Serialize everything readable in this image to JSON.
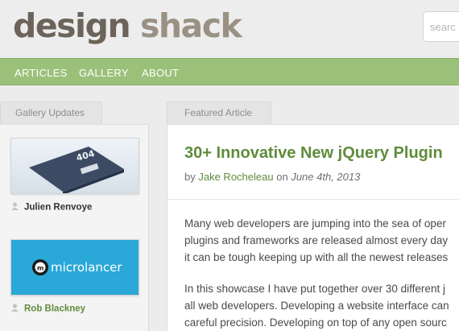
{
  "header": {
    "logo_word1": "design",
    "logo_word2": "shack",
    "search_placeholder": "searc"
  },
  "nav": {
    "items": [
      "ARTICLES",
      "GALLERY",
      "ABOUT"
    ]
  },
  "sidebar": {
    "tab_label": "Gallery Updates",
    "entries": [
      {
        "thumb_text": "404",
        "author": "Julien Renvoye"
      },
      {
        "thumb_text": "microlancer",
        "author": "Rob Blackney"
      }
    ]
  },
  "article": {
    "tab_label": "Featured Article",
    "title": "30+ Innovative New jQuery Plugin",
    "by_prefix": "by",
    "author": "Jake Rocheleau",
    "on_word": "on",
    "date": "June 4th, 2013",
    "paragraph1": [
      "Many web developers are jumping into the sea of oper",
      "plugins and frameworks are released almost every day",
      "it can be tough keeping up with all the newest releases"
    ],
    "paragraph2": [
      "In this showcase I have put together over 30 different j",
      "all web developers. Developing a website interface can",
      "careful precision. Developing on top of any open sourc"
    ]
  },
  "colors": {
    "nav_green": "#9bc07a",
    "link_green": "#5f8c3c",
    "logo_dark": "#6c645a",
    "logo_light": "#9a9184",
    "microlancer_blue": "#2aa8d8"
  }
}
